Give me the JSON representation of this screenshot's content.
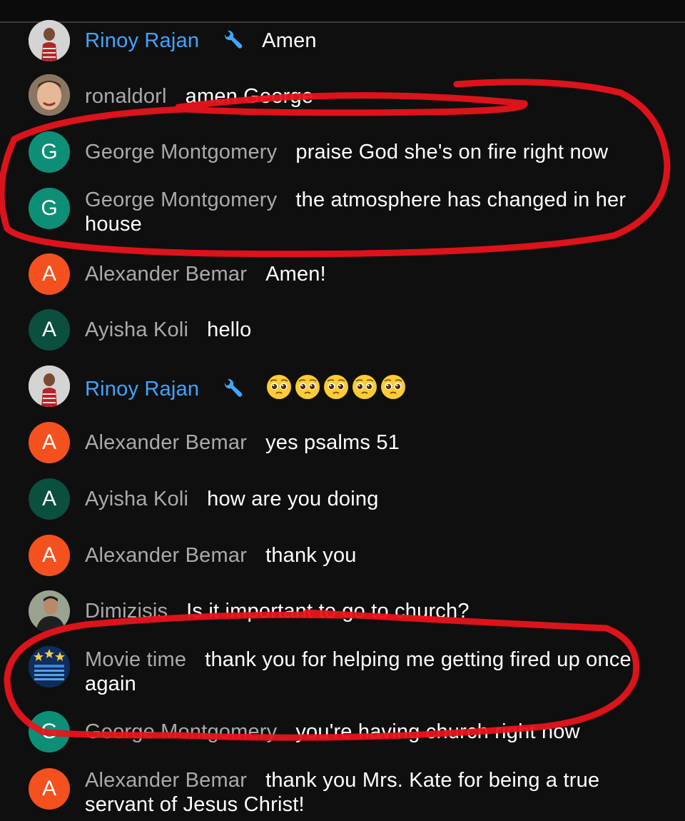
{
  "messages": [
    {
      "author": "Rinoy Rajan",
      "text": "Amen",
      "avatar": "photo-rinoy",
      "owner": true
    },
    {
      "author": "ronaldorl",
      "text": "amen George",
      "avatar": "photo-ronald",
      "owner": false
    },
    {
      "author": "George Montgomery",
      "text": "praise God she's on fire right now",
      "avatar_letter": "G",
      "avatar_color": "#0d8f77",
      "owner": false
    },
    {
      "author": "George Montgomery",
      "text": "the atmosphere has changed in her house",
      "avatar_letter": "G",
      "avatar_color": "#0d8f77",
      "owner": false
    },
    {
      "author": "Alexander Bemar",
      "text": "Amen!",
      "avatar_letter": "A",
      "avatar_color": "#f4511e",
      "owner": false
    },
    {
      "author": "Ayisha Koli",
      "text": "hello",
      "avatar_letter": "A",
      "avatar_color": "#0b4f3f",
      "owner": false
    },
    {
      "author": "Rinoy Rajan",
      "text": "",
      "avatar": "photo-rinoy",
      "owner": true,
      "emoji": [
        "pleading-face",
        "pleading-face",
        "pleading-face",
        "pleading-face",
        "pleading-face"
      ]
    },
    {
      "author": "Alexander Bemar",
      "text": "yes psalms 51",
      "avatar_letter": "A",
      "avatar_color": "#f4511e",
      "owner": false
    },
    {
      "author": "Ayisha Koli",
      "text": "how are you doing",
      "avatar_letter": "A",
      "avatar_color": "#0b4f3f",
      "owner": false
    },
    {
      "author": "Alexander Bemar",
      "text": "thank you",
      "avatar_letter": "A",
      "avatar_color": "#f4511e",
      "owner": false
    },
    {
      "author": "Dimizisis",
      "text": "Is it important to go to church?",
      "avatar": "photo-dimi",
      "owner": false
    },
    {
      "author": "Movie time",
      "text": "thank you for helping me getting fired up once again",
      "avatar": "photo-movie",
      "owner": false
    },
    {
      "author": "George Montgomery",
      "text": "you're having church right now",
      "avatar_letter": "G",
      "avatar_color": "#0d8f77",
      "owner": false
    },
    {
      "author": "Alexander Bemar",
      "text": "thank you Mrs. Kate for being a true servant of Jesus Christ!",
      "avatar_letter": "A",
      "avatar_color": "#f4511e",
      "owner": false
    }
  ],
  "colors": {
    "background": "#0f0f0f",
    "author": "#aaaaaa",
    "owner_author": "#3ea6ff",
    "annotation": "#e8141b"
  },
  "icons": {
    "owner_badge": "wrench-icon",
    "emoji": "pleading-face-emoji"
  }
}
